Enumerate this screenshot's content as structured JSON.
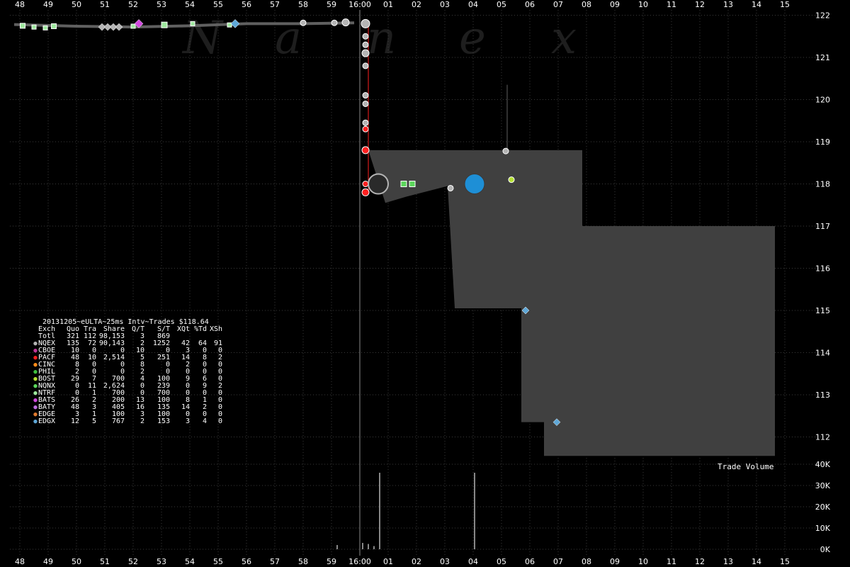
{
  "watermark": "Nanex",
  "colors": {
    "background": "#000000",
    "grid": "#3a3a3a",
    "nbbo_fill": "#404040",
    "price_line": "#606060",
    "session_line": "#8a8a8a",
    "nqex": "#b4b4b4",
    "cboe": "#c0389a",
    "pacf": "#ff2020",
    "cinc": "#ff8c1a",
    "phil": "#3fbf3f",
    "bost": "#b6e234",
    "nqnx": "#5cd65c",
    "ntrf": "#9ee89e",
    "bats": "#d24ae0",
    "baty": "#c06ee0",
    "edge": "#e07a2e",
    "edgx": "#5fa8d8",
    "highlight_circle": "#1e8fd6"
  },
  "chart_data": {
    "type": "scatter",
    "title": "",
    "x_axis": {
      "tick_labels": [
        "48",
        "49",
        "50",
        "51",
        "52",
        "53",
        "54",
        "55",
        "56",
        "57",
        "58",
        "59",
        "16:00",
        "01",
        "02",
        "03",
        "04",
        "05",
        "06",
        "07",
        "08",
        "09",
        "10",
        "11",
        "12",
        "13",
        "14",
        "15"
      ],
      "range_minutes": [
        -12.5,
        15.5
      ],
      "session_boundary": "16:00"
    },
    "y_axis_price": {
      "tick_labels": [
        "122",
        "121",
        "120",
        "119",
        "118",
        "117",
        "116",
        "115",
        "114",
        "113",
        "112"
      ],
      "range": [
        111.5,
        122.3
      ]
    },
    "y_axis_volume": {
      "label": "Trade Volume",
      "tick_labels": [
        "40K",
        "30K",
        "20K",
        "10K",
        "0K"
      ],
      "range": [
        0,
        40000
      ]
    },
    "nbbo_band": [
      {
        "t": 0.3,
        "bid": 118.8,
        "ask": 118.8
      },
      {
        "t": 0.9,
        "bid": 117.55,
        "ask": 118.8
      },
      {
        "t": 1.65,
        "bid": 117.7,
        "ask": 118.8
      },
      {
        "t": 3.1,
        "bid": 117.95,
        "ask": 118.8
      },
      {
        "t": 3.35,
        "bid": 115.05,
        "ask": 118.8
      },
      {
        "t": 5.7,
        "bid": 115.05,
        "ask": 118.8
      },
      {
        "t": 5.7,
        "bid": 112.35,
        "ask": 118.8
      },
      {
        "t": 6.5,
        "bid": 112.35,
        "ask": 118.8
      },
      {
        "t": 6.5,
        "bid": 111.55,
        "ask": 118.8
      },
      {
        "t": 7.85,
        "bid": 111.55,
        "ask": 118.8
      },
      {
        "t": 7.85,
        "bid": 111.55,
        "ask": 117.0
      },
      {
        "t": 14.65,
        "bid": 111.55,
        "ask": 117.0
      }
    ],
    "pre_close_price": [
      {
        "t": -12.2,
        "p": 121.78
      },
      {
        "t": -10.0,
        "p": 121.74
      },
      {
        "t": -8.0,
        "p": 121.72
      },
      {
        "t": -6.0,
        "p": 121.75
      },
      {
        "t": -4.0,
        "p": 121.8
      },
      {
        "t": -2.0,
        "p": 121.8
      },
      {
        "t": -0.2,
        "p": 121.82
      }
    ],
    "trades": [
      {
        "t": -11.9,
        "p": 121.75,
        "ex": "ntrf",
        "shape": "square",
        "size": 7
      },
      {
        "t": -11.5,
        "p": 121.72,
        "ex": "ntrf",
        "shape": "square",
        "size": 6
      },
      {
        "t": -11.1,
        "p": 121.7,
        "ex": "ntrf",
        "shape": "square",
        "size": 6
      },
      {
        "t": -10.8,
        "p": 121.74,
        "ex": "ntrf",
        "shape": "square",
        "size": 7
      },
      {
        "t": -9.1,
        "p": 121.72,
        "ex": "nqex",
        "shape": "diamond",
        "size": 5
      },
      {
        "t": -8.9,
        "p": 121.72,
        "ex": "nqex",
        "shape": "diamond",
        "size": 5
      },
      {
        "t": -8.7,
        "p": 121.72,
        "ex": "nqex",
        "shape": "diamond",
        "size": 5
      },
      {
        "t": -8.5,
        "p": 121.72,
        "ex": "nqex",
        "shape": "diamond",
        "size": 5
      },
      {
        "t": -8.0,
        "p": 121.74,
        "ex": "ntrf",
        "shape": "square",
        "size": 6
      },
      {
        "t": -7.8,
        "p": 121.8,
        "ex": "bats",
        "shape": "diamond",
        "size": 6
      },
      {
        "t": -6.9,
        "p": 121.77,
        "ex": "ntrf",
        "shape": "square",
        "size": 8
      },
      {
        "t": -5.9,
        "p": 121.8,
        "ex": "ntrf",
        "shape": "square",
        "size": 6
      },
      {
        "t": -4.6,
        "p": 121.77,
        "ex": "ntrf",
        "shape": "square",
        "size": 6
      },
      {
        "t": -4.4,
        "p": 121.8,
        "ex": "edgx",
        "shape": "diamond",
        "size": 6
      },
      {
        "t": -2.0,
        "p": 121.82,
        "ex": "nqex",
        "shape": "circle",
        "size": 4
      },
      {
        "t": -0.9,
        "p": 121.82,
        "ex": "nqex",
        "shape": "circle",
        "size": 4
      },
      {
        "t": -0.5,
        "p": 121.83,
        "ex": "nqex",
        "shape": "circle",
        "size": 5
      },
      {
        "t": 0.2,
        "p": 121.8,
        "ex": "nqex",
        "shape": "circle",
        "size": 6
      },
      {
        "t": 0.2,
        "p": 121.5,
        "ex": "nqex",
        "shape": "circle",
        "size": 4
      },
      {
        "t": 0.2,
        "p": 121.3,
        "ex": "nqex",
        "shape": "circle",
        "size": 4
      },
      {
        "t": 0.2,
        "p": 121.1,
        "ex": "nqex",
        "shape": "circle",
        "size": 5
      },
      {
        "t": 0.2,
        "p": 120.8,
        "ex": "nqex",
        "shape": "circle",
        "size": 4
      },
      {
        "t": 0.2,
        "p": 120.1,
        "ex": "nqex",
        "shape": "circle",
        "size": 4
      },
      {
        "t": 0.2,
        "p": 119.9,
        "ex": "nqex",
        "shape": "circle",
        "size": 4
      },
      {
        "t": 0.2,
        "p": 119.45,
        "ex": "nqex",
        "shape": "circle",
        "size": 4
      },
      {
        "t": 0.2,
        "p": 119.3,
        "ex": "pacf",
        "shape": "circle",
        "size": 4
      },
      {
        "t": 0.2,
        "p": 118.8,
        "ex": "pacf",
        "shape": "circle",
        "size": 5
      },
      {
        "t": 0.2,
        "p": 118.0,
        "ex": "pacf",
        "shape": "circle",
        "size": 4
      },
      {
        "t": 0.2,
        "p": 117.8,
        "ex": "pacf",
        "shape": "circle",
        "size": 5
      },
      {
        "t": 0.65,
        "p": 118.0,
        "ex": "nqex",
        "shape": "circle",
        "size": 14,
        "dark": true
      },
      {
        "t": 1.55,
        "p": 118.0,
        "ex": "nqnx",
        "shape": "square",
        "size": 8
      },
      {
        "t": 1.85,
        "p": 118.0,
        "ex": "nqnx",
        "shape": "square",
        "size": 8
      },
      {
        "t": 3.2,
        "p": 117.9,
        "ex": "nqex",
        "shape": "circle",
        "size": 4
      },
      {
        "t": 4.05,
        "p": 118.0,
        "ex": "highlight",
        "shape": "circle",
        "size": 14
      },
      {
        "t": 5.15,
        "p": 118.78,
        "ex": "nqex",
        "shape": "circle",
        "size": 4
      },
      {
        "t": 5.35,
        "p": 118.1,
        "ex": "bost",
        "shape": "circle",
        "size": 4
      },
      {
        "t": 5.85,
        "p": 115.0,
        "ex": "edgx",
        "shape": "diamond",
        "size": 5
      },
      {
        "t": 6.95,
        "p": 112.35,
        "ex": "edgx",
        "shape": "diamond",
        "size": 5
      }
    ],
    "volume_bars": [
      {
        "t": 0.7,
        "v": 36000
      },
      {
        "t": 4.05,
        "v": 36000
      },
      {
        "t": -0.8,
        "v": 2000
      },
      {
        "t": 0.1,
        "v": 3000
      },
      {
        "t": 0.3,
        "v": 2500
      },
      {
        "t": 0.5,
        "v": 1500
      }
    ]
  },
  "stats_panel": {
    "title": "20131205~eULTA~25ms Intv~Trades $118.64",
    "headers": [
      "Exch",
      "Quo",
      "Tra",
      "Share",
      "Q/T",
      "S/T",
      "XQt",
      "%Td",
      "XSh"
    ],
    "rows": [
      {
        "color": "",
        "cells": [
          "Totl",
          "321",
          "112",
          "98,153",
          "3",
          "869",
          "",
          "",
          ""
        ]
      },
      {
        "color": "#b4b4b4",
        "cells": [
          "NQEX",
          "135",
          "72",
          "90,143",
          "2",
          "1252",
          "42",
          "64",
          "91"
        ]
      },
      {
        "color": "#c0389a",
        "cells": [
          "CBOE",
          "10",
          "0",
          "0",
          "10",
          "0",
          "3",
          "0",
          "0"
        ]
      },
      {
        "color": "#ff2020",
        "cells": [
          "PACF",
          "48",
          "10",
          "2,514",
          "5",
          "251",
          "14",
          "8",
          "2"
        ]
      },
      {
        "color": "#ff8c1a",
        "cells": [
          "CINC",
          "8",
          "0",
          "0",
          "8",
          "0",
          "2",
          "0",
          "0"
        ]
      },
      {
        "color": "#3fbf3f",
        "cells": [
          "PHIL",
          "2",
          "0",
          "0",
          "2",
          "0",
          "0",
          "0",
          "0"
        ]
      },
      {
        "color": "#b6e234",
        "cells": [
          "BOST",
          "29",
          "7",
          "700",
          "4",
          "100",
          "9",
          "6",
          "0"
        ]
      },
      {
        "color": "#5cd65c",
        "cells": [
          "NQNX",
          "0",
          "11",
          "2,624",
          "0",
          "239",
          "0",
          "9",
          "2"
        ]
      },
      {
        "color": "#9ee89e",
        "cells": [
          "NTRF",
          "0",
          "1",
          "700",
          "0",
          "700",
          "0",
          "0",
          "0"
        ]
      },
      {
        "color": "#d24ae0",
        "cells": [
          "BATS",
          "26",
          "2",
          "200",
          "13",
          "100",
          "8",
          "1",
          "0"
        ]
      },
      {
        "color": "#c06ee0",
        "cells": [
          "BATY",
          "48",
          "3",
          "405",
          "16",
          "135",
          "14",
          "2",
          "0"
        ]
      },
      {
        "color": "#e07a2e",
        "cells": [
          "EDGE",
          "3",
          "1",
          "100",
          "3",
          "100",
          "0",
          "0",
          "0"
        ]
      },
      {
        "color": "#5fa8d8",
        "cells": [
          "EDGX",
          "12",
          "5",
          "767",
          "2",
          "153",
          "3",
          "4",
          "0"
        ]
      }
    ]
  }
}
